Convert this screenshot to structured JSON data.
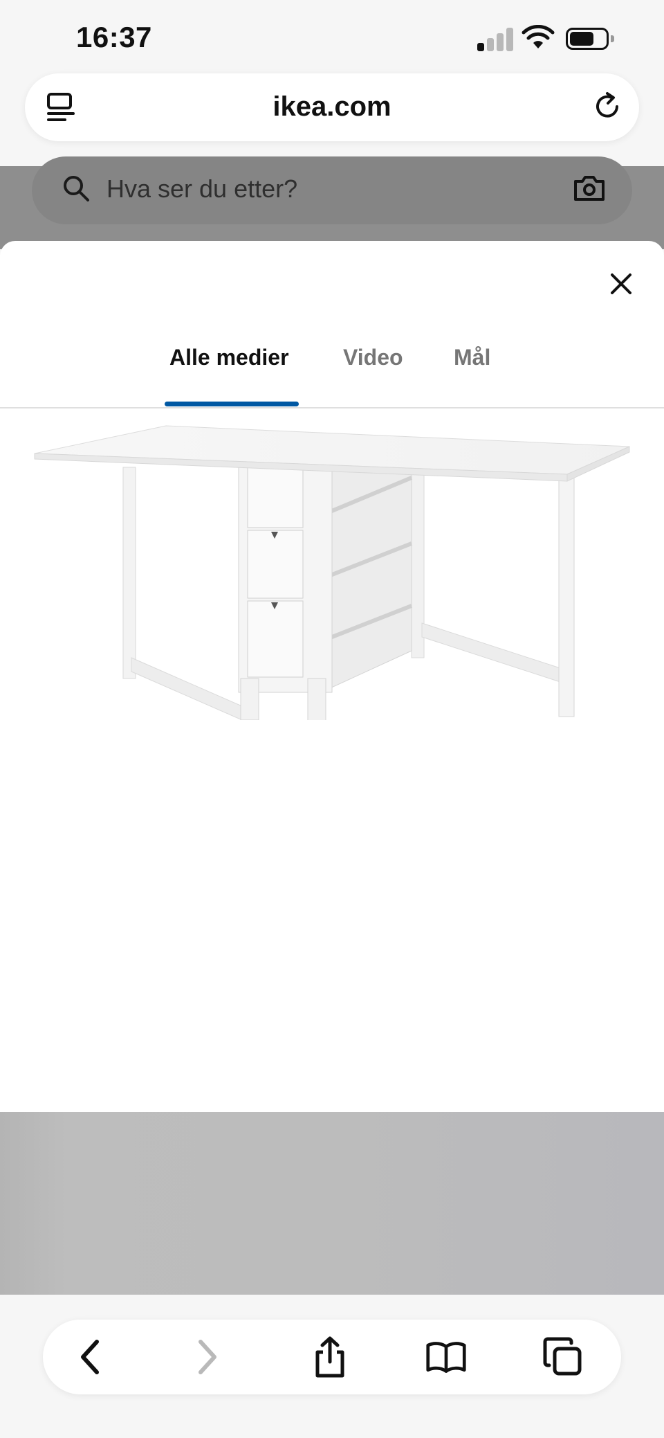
{
  "status_bar": {
    "time": "16:37"
  },
  "url_bar": {
    "url": "ikea.com",
    "left_icon": "page-menu-icon",
    "right_icon": "reload-icon"
  },
  "search": {
    "placeholder": "Hva ser du etter?",
    "left_icon": "search-icon",
    "right_icon": "camera-icon"
  },
  "media_modal": {
    "close_icon": "close-icon",
    "tabs": [
      {
        "label": "Alle medier",
        "active": true
      },
      {
        "label": "Video",
        "active": false
      },
      {
        "label": "Mål",
        "active": false
      }
    ],
    "image": "gateleg table with drawers, white"
  },
  "toolbar": {
    "buttons": [
      {
        "name": "back-icon",
        "enabled": true
      },
      {
        "name": "forward-icon",
        "enabled": false
      },
      {
        "name": "share-icon",
        "enabled": true
      },
      {
        "name": "bookmarks-icon",
        "enabled": true
      },
      {
        "name": "tabs-icon",
        "enabled": true
      }
    ]
  },
  "colors": {
    "accent": "#0058a3",
    "overlay": "#8e8e8e",
    "active_tab_text": "#111111",
    "inactive_tab_text": "#767676"
  }
}
